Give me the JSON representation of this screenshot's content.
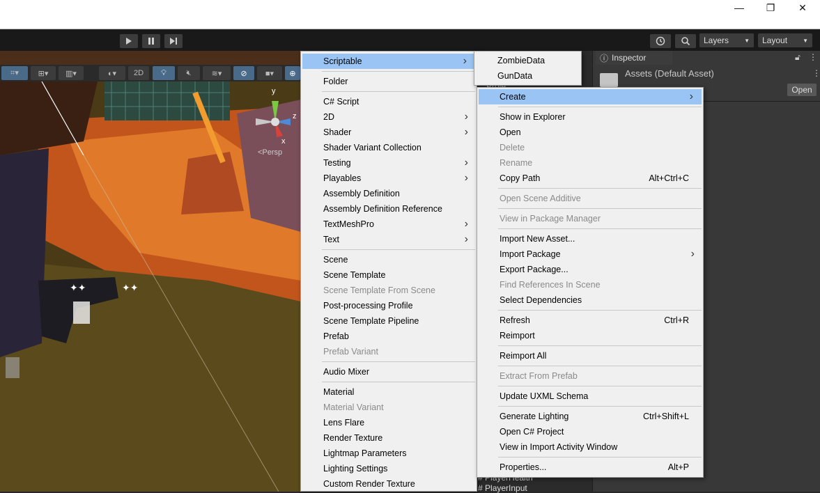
{
  "window_controls": {
    "minimize": "—",
    "maximize": "❐",
    "close": "✕"
  },
  "toolbar": {
    "layers_label": "Layers",
    "layout_label": "Layout"
  },
  "scene": {
    "toggle_2d": "2D",
    "gizmo_y": "y",
    "gizmo_z": "z",
    "gizmo_x": "x",
    "persp_label": "<Persp"
  },
  "inspector": {
    "tab_label": "Inspector",
    "asset_title": "Assets (Default Asset)",
    "open_button": "Open"
  },
  "project": {
    "tab_partial": "Proje",
    "bottom_items": [
      "PlayerHealth",
      "PlayerInput"
    ]
  },
  "scriptable_submenu": [
    "ZombieData",
    "GunData"
  ],
  "create_menu": {
    "groups": [
      [
        {
          "label": "Scriptable",
          "arrow": true,
          "highlight": true
        }
      ],
      [
        {
          "label": "Folder"
        }
      ],
      [
        {
          "label": "C# Script"
        },
        {
          "label": "2D",
          "arrow": true
        },
        {
          "label": "Shader",
          "arrow": true
        },
        {
          "label": "Shader Variant Collection"
        },
        {
          "label": "Testing",
          "arrow": true
        },
        {
          "label": "Playables",
          "arrow": true
        },
        {
          "label": "Assembly Definition"
        },
        {
          "label": "Assembly Definition Reference"
        },
        {
          "label": "TextMeshPro",
          "arrow": true
        },
        {
          "label": "Text",
          "arrow": true
        }
      ],
      [
        {
          "label": "Scene"
        },
        {
          "label": "Scene Template"
        },
        {
          "label": "Scene Template From Scene",
          "disabled": true
        },
        {
          "label": "Post-processing Profile"
        },
        {
          "label": "Scene Template Pipeline"
        },
        {
          "label": "Prefab"
        },
        {
          "label": "Prefab Variant",
          "disabled": true
        }
      ],
      [
        {
          "label": "Audio Mixer"
        }
      ],
      [
        {
          "label": "Material"
        },
        {
          "label": "Material Variant",
          "disabled": true
        },
        {
          "label": "Lens Flare"
        },
        {
          "label": "Render Texture"
        },
        {
          "label": "Lightmap Parameters"
        },
        {
          "label": "Lighting Settings"
        },
        {
          "label": "Custom Render Texture"
        }
      ]
    ]
  },
  "context_menu": {
    "groups": [
      [
        {
          "label": "Create",
          "arrow": true,
          "highlight": true
        }
      ],
      [
        {
          "label": "Show in Explorer"
        },
        {
          "label": "Open"
        },
        {
          "label": "Delete",
          "disabled": true
        },
        {
          "label": "Rename",
          "disabled": true
        },
        {
          "label": "Copy Path",
          "shortcut": "Alt+Ctrl+C"
        }
      ],
      [
        {
          "label": "Open Scene Additive",
          "disabled": true
        }
      ],
      [
        {
          "label": "View in Package Manager",
          "disabled": true
        }
      ],
      [
        {
          "label": "Import New Asset..."
        },
        {
          "label": "Import Package",
          "arrow": true
        },
        {
          "label": "Export Package..."
        },
        {
          "label": "Find References In Scene",
          "disabled": true
        },
        {
          "label": "Select Dependencies"
        }
      ],
      [
        {
          "label": "Refresh",
          "shortcut": "Ctrl+R"
        },
        {
          "label": "Reimport"
        }
      ],
      [
        {
          "label": "Reimport All"
        }
      ],
      [
        {
          "label": "Extract From Prefab",
          "disabled": true
        }
      ],
      [
        {
          "label": "Update UXML Schema"
        }
      ],
      [
        {
          "label": "Generate Lighting",
          "shortcut": "Ctrl+Shift+L"
        },
        {
          "label": "Open C# Project"
        },
        {
          "label": "View in Import Activity Window"
        }
      ],
      [
        {
          "label": "Properties...",
          "shortcut": "Alt+P"
        }
      ]
    ]
  }
}
